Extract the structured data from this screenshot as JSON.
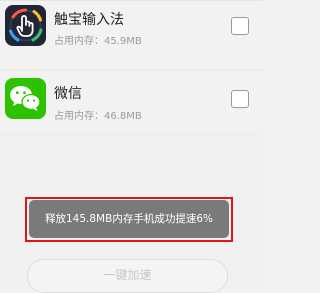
{
  "apps": [
    {
      "name": "触宝输入法",
      "memory": "占用内存：45.9MB",
      "icon": "touchpal-keyboard-icon",
      "checked": false
    },
    {
      "name": "微信",
      "memory": "占用内存：46.8MB",
      "icon": "wechat-icon",
      "checked": false
    }
  ],
  "toast": {
    "message": "释放145.8MB内存手机成功提速6%"
  },
  "action": {
    "accelerate_label": "一键加速"
  },
  "colors": {
    "wechat_green": "#2dc100",
    "touchpal_dark": "#202636",
    "highlight_border": "#e0141a",
    "toast_bg": "#7a7a7a"
  }
}
